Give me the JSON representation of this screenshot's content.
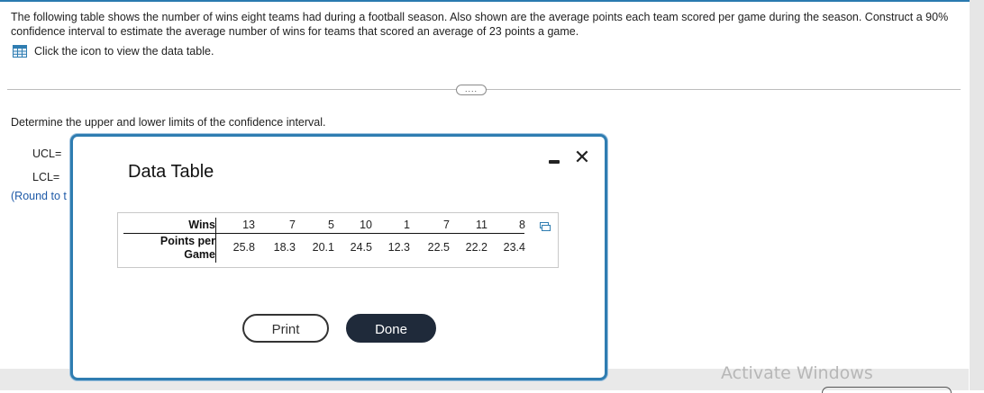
{
  "question": {
    "text": "The following table shows the number of wins eight teams had during a football season. Also shown are the average points each team scored per game during the season. Construct a 90% confidence interval to estimate the average number of wins for teams that scored an average of 23 points a game.",
    "data_link_label": "Click the icon to view the data table.",
    "data_icon": "table-grid-icon",
    "expander_text": "...."
  },
  "answer_section": {
    "prompt": "Determine the upper and lower limits of the confidence interval.",
    "ucl_label": "UCL=",
    "lcl_label": "LCL=",
    "round_note": "(Round to t"
  },
  "modal": {
    "title": "Data Table",
    "minimize_icon": "minimize-icon",
    "close_icon": "close-icon",
    "copy_icon": "copy-icon",
    "table": {
      "row1_label": "Wins",
      "row2_label_line1": "Points per",
      "row2_label_line2": "Game",
      "wins": [
        "13",
        "7",
        "5",
        "10",
        "1",
        "7",
        "11",
        "8"
      ],
      "points": [
        "25.8",
        "18.3",
        "20.1",
        "24.5",
        "12.3",
        "22.5",
        "22.2",
        "23.4"
      ]
    },
    "print_label": "Print",
    "done_label": "Done"
  },
  "watermark": "Activate Windows",
  "colors": {
    "modal_border": "#2f7db1",
    "done_button": "#1f2a3a",
    "link_blue": "#1e5aa8"
  }
}
